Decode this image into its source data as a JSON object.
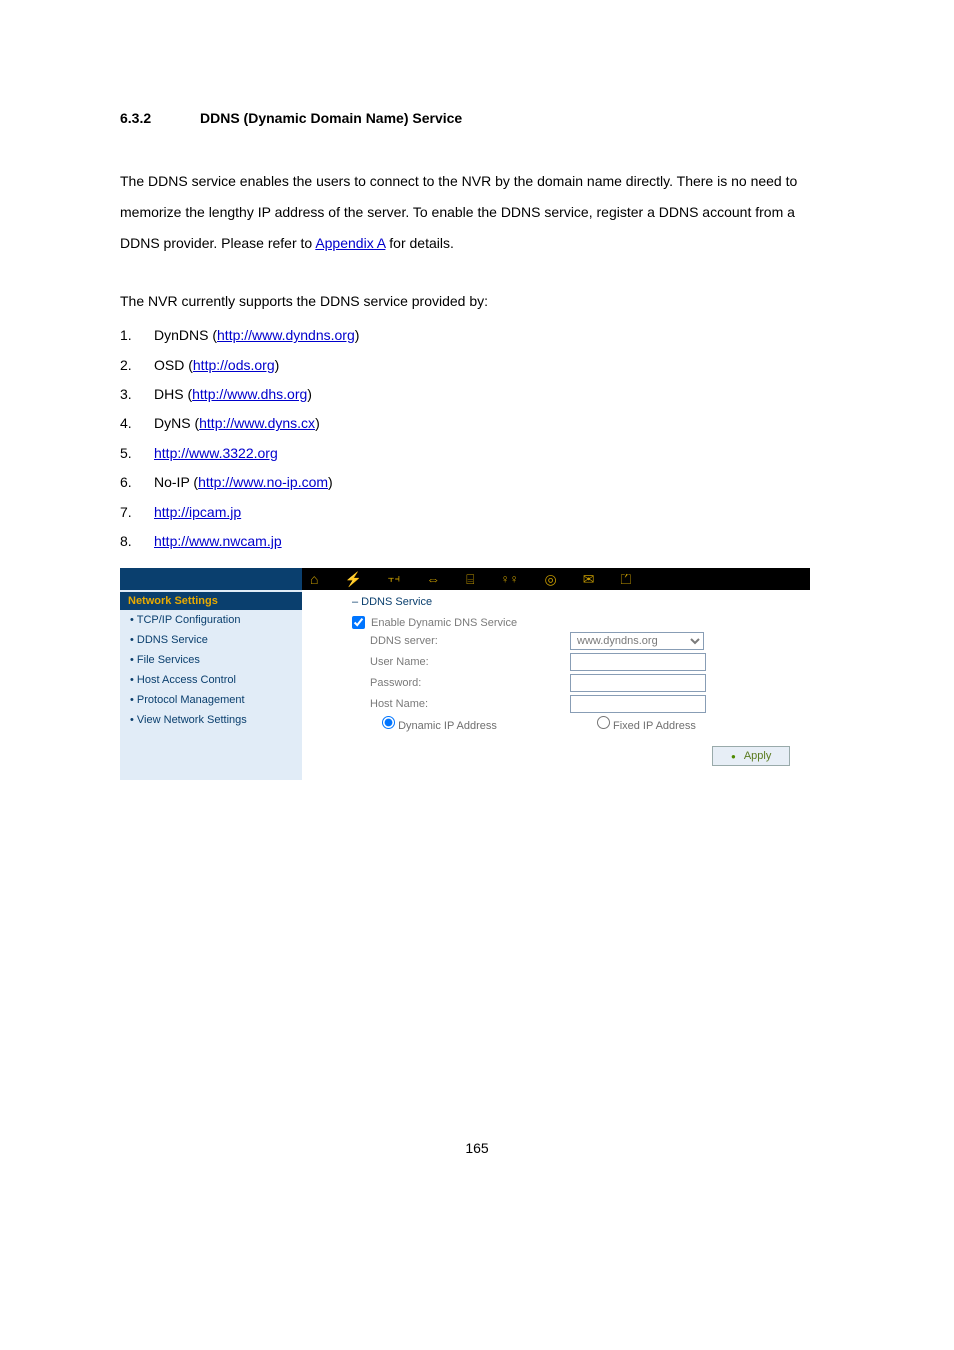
{
  "heading": {
    "num": "6.3.2",
    "title": "DDNS (Dynamic Domain Name) Service"
  },
  "para1_a": "The DDNS service enables the users to connect to the NVR by the domain name directly.  There is no need to memorize the lengthy IP address of the server.   To enable the DDNS service, register a DDNS account from a DDNS provider.   Please refer to ",
  "para1_link": "Appendix A",
  "para1_b": " for details.",
  "para2": "The NVR currently supports the DDNS service provided by:",
  "list": [
    {
      "n": "1.",
      "pre": "DynDNS (",
      "url": "http://www.dyndns.org",
      "post": ")"
    },
    {
      "n": "2.",
      "pre": "OSD (",
      "url": "http://ods.org",
      "post": ")"
    },
    {
      "n": "3.",
      "pre": "DHS (",
      "url": "http://www.dhs.org",
      "post": ")"
    },
    {
      "n": "4.",
      "pre": "DyNS (",
      "url": "http://www.dyns.cx",
      "post": ")"
    },
    {
      "n": "5.",
      "pre": "",
      "url": "http://www.3322.org",
      "post": ""
    },
    {
      "n": "6.",
      "pre": "No-IP (",
      "url": "http://www.no-ip.com",
      "post": ")"
    },
    {
      "n": "7.",
      "pre": "",
      "url": "http://ipcam.jp",
      "post": ""
    },
    {
      "n": "8.",
      "pre": "",
      "url": "http://www.nwcam.jp",
      "post": ""
    }
  ],
  "sidebar": {
    "header": "Network Settings",
    "items": [
      "TCP/IP Configuration",
      "DDNS Service",
      "File Services",
      "Host Access Control",
      "Protocol Management",
      "View Network Settings"
    ]
  },
  "form": {
    "section": "–  DDNS Service",
    "enable": "Enable Dynamic DNS Service",
    "server_label": "DDNS server:",
    "server_value": "www.dyndns.org",
    "user_label": "User Name:",
    "pass_label": "Password:",
    "host_label": "Host Name:",
    "dyn": "Dynamic IP Address",
    "fix": "Fixed IP Address",
    "apply": "Apply"
  },
  "page_number": "165"
}
